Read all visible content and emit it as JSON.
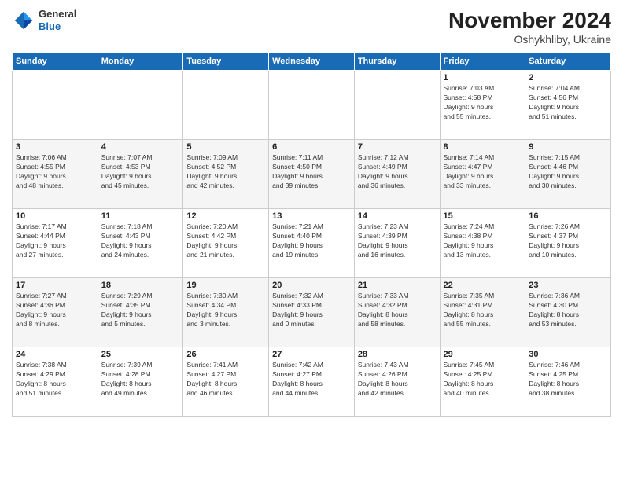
{
  "logo": {
    "line1": "General",
    "line2": "Blue"
  },
  "header": {
    "month": "November 2024",
    "location": "Oshykhliby, Ukraine"
  },
  "weekdays": [
    "Sunday",
    "Monday",
    "Tuesday",
    "Wednesday",
    "Thursday",
    "Friday",
    "Saturday"
  ],
  "weeks": [
    [
      {
        "day": "",
        "info": ""
      },
      {
        "day": "",
        "info": ""
      },
      {
        "day": "",
        "info": ""
      },
      {
        "day": "",
        "info": ""
      },
      {
        "day": "",
        "info": ""
      },
      {
        "day": "1",
        "info": "Sunrise: 7:03 AM\nSunset: 4:58 PM\nDaylight: 9 hours\nand 55 minutes."
      },
      {
        "day": "2",
        "info": "Sunrise: 7:04 AM\nSunset: 4:56 PM\nDaylight: 9 hours\nand 51 minutes."
      }
    ],
    [
      {
        "day": "3",
        "info": "Sunrise: 7:06 AM\nSunset: 4:55 PM\nDaylight: 9 hours\nand 48 minutes."
      },
      {
        "day": "4",
        "info": "Sunrise: 7:07 AM\nSunset: 4:53 PM\nDaylight: 9 hours\nand 45 minutes."
      },
      {
        "day": "5",
        "info": "Sunrise: 7:09 AM\nSunset: 4:52 PM\nDaylight: 9 hours\nand 42 minutes."
      },
      {
        "day": "6",
        "info": "Sunrise: 7:11 AM\nSunset: 4:50 PM\nDaylight: 9 hours\nand 39 minutes."
      },
      {
        "day": "7",
        "info": "Sunrise: 7:12 AM\nSunset: 4:49 PM\nDaylight: 9 hours\nand 36 minutes."
      },
      {
        "day": "8",
        "info": "Sunrise: 7:14 AM\nSunset: 4:47 PM\nDaylight: 9 hours\nand 33 minutes."
      },
      {
        "day": "9",
        "info": "Sunrise: 7:15 AM\nSunset: 4:46 PM\nDaylight: 9 hours\nand 30 minutes."
      }
    ],
    [
      {
        "day": "10",
        "info": "Sunrise: 7:17 AM\nSunset: 4:44 PM\nDaylight: 9 hours\nand 27 minutes."
      },
      {
        "day": "11",
        "info": "Sunrise: 7:18 AM\nSunset: 4:43 PM\nDaylight: 9 hours\nand 24 minutes."
      },
      {
        "day": "12",
        "info": "Sunrise: 7:20 AM\nSunset: 4:42 PM\nDaylight: 9 hours\nand 21 minutes."
      },
      {
        "day": "13",
        "info": "Sunrise: 7:21 AM\nSunset: 4:40 PM\nDaylight: 9 hours\nand 19 minutes."
      },
      {
        "day": "14",
        "info": "Sunrise: 7:23 AM\nSunset: 4:39 PM\nDaylight: 9 hours\nand 16 minutes."
      },
      {
        "day": "15",
        "info": "Sunrise: 7:24 AM\nSunset: 4:38 PM\nDaylight: 9 hours\nand 13 minutes."
      },
      {
        "day": "16",
        "info": "Sunrise: 7:26 AM\nSunset: 4:37 PM\nDaylight: 9 hours\nand 10 minutes."
      }
    ],
    [
      {
        "day": "17",
        "info": "Sunrise: 7:27 AM\nSunset: 4:36 PM\nDaylight: 9 hours\nand 8 minutes."
      },
      {
        "day": "18",
        "info": "Sunrise: 7:29 AM\nSunset: 4:35 PM\nDaylight: 9 hours\nand 5 minutes."
      },
      {
        "day": "19",
        "info": "Sunrise: 7:30 AM\nSunset: 4:34 PM\nDaylight: 9 hours\nand 3 minutes."
      },
      {
        "day": "20",
        "info": "Sunrise: 7:32 AM\nSunset: 4:33 PM\nDaylight: 9 hours\nand 0 minutes."
      },
      {
        "day": "21",
        "info": "Sunrise: 7:33 AM\nSunset: 4:32 PM\nDaylight: 8 hours\nand 58 minutes."
      },
      {
        "day": "22",
        "info": "Sunrise: 7:35 AM\nSunset: 4:31 PM\nDaylight: 8 hours\nand 55 minutes."
      },
      {
        "day": "23",
        "info": "Sunrise: 7:36 AM\nSunset: 4:30 PM\nDaylight: 8 hours\nand 53 minutes."
      }
    ],
    [
      {
        "day": "24",
        "info": "Sunrise: 7:38 AM\nSunset: 4:29 PM\nDaylight: 8 hours\nand 51 minutes."
      },
      {
        "day": "25",
        "info": "Sunrise: 7:39 AM\nSunset: 4:28 PM\nDaylight: 8 hours\nand 49 minutes."
      },
      {
        "day": "26",
        "info": "Sunrise: 7:41 AM\nSunset: 4:27 PM\nDaylight: 8 hours\nand 46 minutes."
      },
      {
        "day": "27",
        "info": "Sunrise: 7:42 AM\nSunset: 4:27 PM\nDaylight: 8 hours\nand 44 minutes."
      },
      {
        "day": "28",
        "info": "Sunrise: 7:43 AM\nSunset: 4:26 PM\nDaylight: 8 hours\nand 42 minutes."
      },
      {
        "day": "29",
        "info": "Sunrise: 7:45 AM\nSunset: 4:25 PM\nDaylight: 8 hours\nand 40 minutes."
      },
      {
        "day": "30",
        "info": "Sunrise: 7:46 AM\nSunset: 4:25 PM\nDaylight: 8 hours\nand 38 minutes."
      }
    ]
  ]
}
